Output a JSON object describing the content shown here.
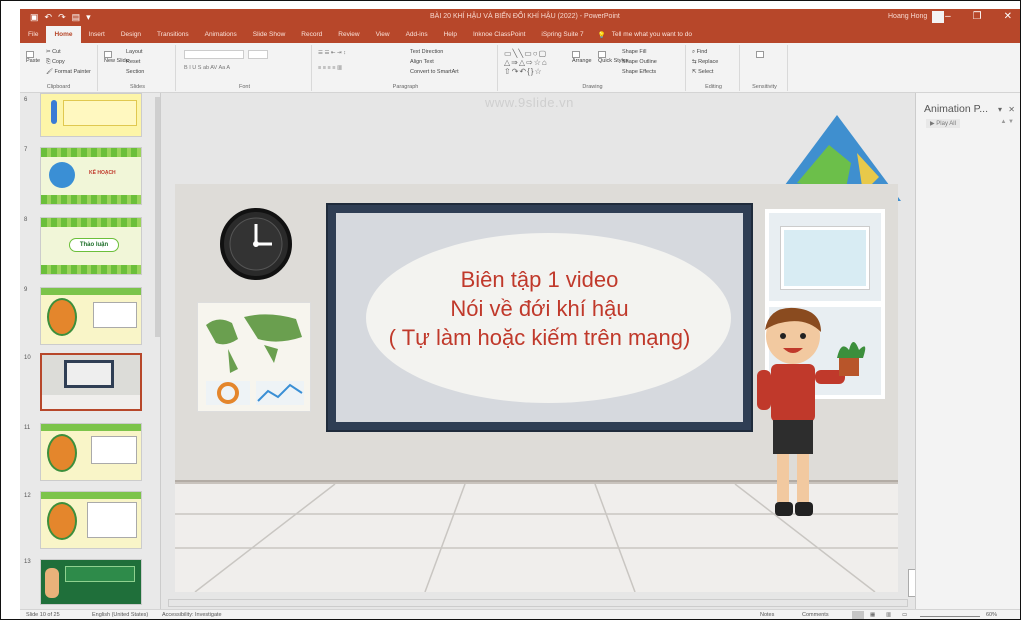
{
  "window": {
    "title": "BÀI 20 KHÍ HẬU VÀ BIẾN ĐỔI KHÍ HẬU (2022) - PowerPoint",
    "user": "Hoang Hong",
    "minimize": "–",
    "restore": "❐",
    "close": "✕"
  },
  "tabs": [
    "File",
    "Home",
    "Insert",
    "Design",
    "Transitions",
    "Animations",
    "Slide Show",
    "Record",
    "Review",
    "View",
    "Add-ins",
    "Help",
    "Inknoe ClassPoint",
    "iSpring Suite 7"
  ],
  "tell_me": "Tell me what you want to do",
  "ribbon": {
    "clipboard": {
      "label": "Clipboard",
      "paste": "Paste",
      "cut": "Cut",
      "copy": "Copy",
      "format_painter": "Format Painter"
    },
    "slides": {
      "label": "Slides",
      "new_slide": "New Slide",
      "layout": "Layout",
      "reset": "Reset",
      "section": "Section"
    },
    "font": {
      "label": "Font"
    },
    "paragraph": {
      "label": "Paragraph",
      "text_direction": "Text Direction",
      "align_text": "Align Text",
      "convert_smartart": "Convert to SmartArt"
    },
    "drawing": {
      "label": "Drawing",
      "arrange": "Arrange",
      "quick_styles": "Quick Styles",
      "shape_fill": "Shape Fill",
      "shape_outline": "Shape Outline",
      "shape_effects": "Shape Effects"
    },
    "editing": {
      "label": "Editing",
      "find": "Find",
      "replace": "Replace",
      "select": "Select"
    },
    "sensitivity": {
      "label": "Sensitivity"
    }
  },
  "watermark": "www.9slide.vn",
  "thumbnails": [
    {
      "num": "6"
    },
    {
      "num": "7",
      "caption": "KẾ HOẠCH"
    },
    {
      "num": "8",
      "caption": "Thảo luận"
    },
    {
      "num": "9"
    },
    {
      "num": "10"
    },
    {
      "num": "11"
    },
    {
      "num": "12"
    },
    {
      "num": "13"
    }
  ],
  "slide": {
    "line1": "Biên tập 1 video",
    "line2": "Nói về đới khí hậu",
    "line3": "( Tự làm hoặc kiếm trên mạng)"
  },
  "anim_pane": {
    "title": "Animation P...",
    "play": "▶ Play All"
  },
  "status": {
    "slide": "Slide 10 of 25",
    "language": "English (United States)",
    "accessibility": "Accessibility: Investigate",
    "notes": "Notes",
    "comments": "Comments",
    "zoom": "60%"
  },
  "colors": {
    "accent": "#b7472a",
    "slide_text": "#c0392b"
  }
}
